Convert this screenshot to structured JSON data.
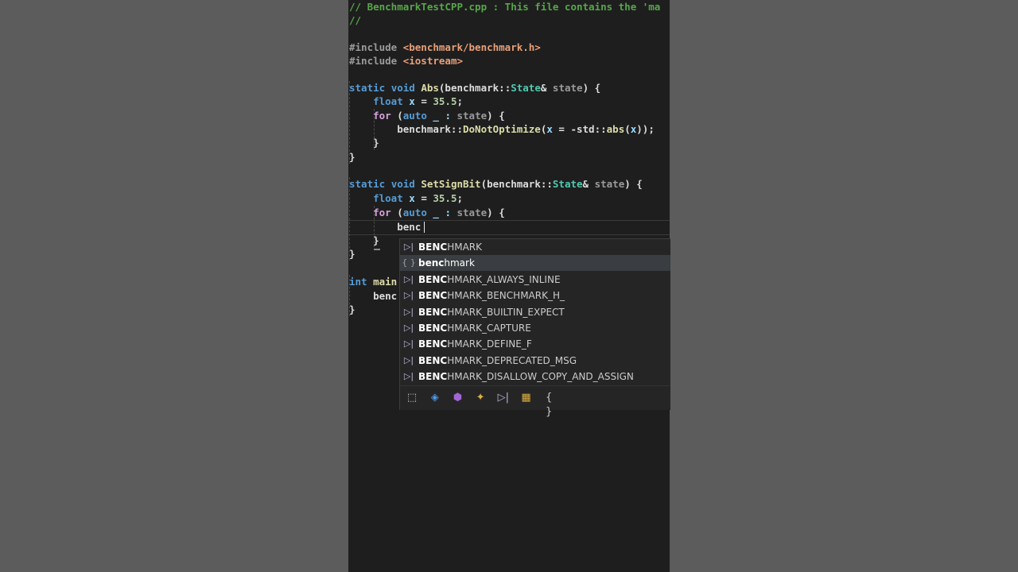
{
  "editor": {
    "lines": [
      {
        "tokens": [
          {
            "t": "// BenchmarkTestCPP.cpp : This file contains the 'ma",
            "c": "comment"
          }
        ]
      },
      {
        "tokens": [
          {
            "t": "//",
            "c": "comment"
          }
        ]
      },
      {
        "tokens": []
      },
      {
        "tokens": [
          {
            "t": "#include ",
            "c": "pp"
          },
          {
            "t": "<benchmark/benchmark.h>",
            "c": "str"
          }
        ]
      },
      {
        "tokens": [
          {
            "t": "#include ",
            "c": "pp"
          },
          {
            "t": "<iostream>",
            "c": "str"
          }
        ]
      },
      {
        "tokens": []
      },
      {
        "tokens": [
          {
            "t": "static ",
            "c": "kw"
          },
          {
            "t": "void ",
            "c": "kw"
          },
          {
            "t": "Abs",
            "c": "fn"
          },
          {
            "t": "(benchmark::",
            "c": "plain"
          },
          {
            "t": "State",
            "c": "type"
          },
          {
            "t": "& ",
            "c": "plain"
          },
          {
            "t": "state",
            "c": "param"
          },
          {
            "t": ") {",
            "c": "plain"
          }
        ]
      },
      {
        "tokens": [
          {
            "t": "    ",
            "c": "plain"
          },
          {
            "t": "float ",
            "c": "kw"
          },
          {
            "t": "x",
            "c": "var"
          },
          {
            "t": " = ",
            "c": "plain"
          },
          {
            "t": "35.5",
            "c": "num"
          },
          {
            "t": ";",
            "c": "plain"
          }
        ]
      },
      {
        "tokens": [
          {
            "t": "    ",
            "c": "plain"
          },
          {
            "t": "for ",
            "c": "ctl"
          },
          {
            "t": "(",
            "c": "plain"
          },
          {
            "t": "auto ",
            "c": "kw"
          },
          {
            "t": "_ : ",
            "c": "var"
          },
          {
            "t": "state",
            "c": "param"
          },
          {
            "t": ") {",
            "c": "plain"
          }
        ]
      },
      {
        "tokens": [
          {
            "t": "        benchmark::",
            "c": "plain"
          },
          {
            "t": "DoNotOptimize",
            "c": "fn"
          },
          {
            "t": "(",
            "c": "plain"
          },
          {
            "t": "x",
            "c": "var"
          },
          {
            "t": " = -std::",
            "c": "plain"
          },
          {
            "t": "abs",
            "c": "fn"
          },
          {
            "t": "(",
            "c": "plain"
          },
          {
            "t": "x",
            "c": "var"
          },
          {
            "t": "));",
            "c": "plain"
          }
        ]
      },
      {
        "tokens": [
          {
            "t": "    }",
            "c": "plain"
          }
        ]
      },
      {
        "tokens": [
          {
            "t": "}",
            "c": "plain"
          }
        ]
      },
      {
        "tokens": []
      },
      {
        "tokens": [
          {
            "t": "static ",
            "c": "kw"
          },
          {
            "t": "void ",
            "c": "kw"
          },
          {
            "t": "SetSignBit",
            "c": "fn"
          },
          {
            "t": "(benchmark::",
            "c": "plain"
          },
          {
            "t": "State",
            "c": "type"
          },
          {
            "t": "& ",
            "c": "plain"
          },
          {
            "t": "state",
            "c": "param"
          },
          {
            "t": ") {",
            "c": "plain"
          }
        ]
      },
      {
        "tokens": [
          {
            "t": "    ",
            "c": "plain"
          },
          {
            "t": "float ",
            "c": "kw"
          },
          {
            "t": "x",
            "c": "var"
          },
          {
            "t": " = ",
            "c": "plain"
          },
          {
            "t": "35.5",
            "c": "num"
          },
          {
            "t": ";",
            "c": "plain"
          }
        ]
      },
      {
        "tokens": [
          {
            "t": "    ",
            "c": "plain"
          },
          {
            "t": "for ",
            "c": "ctl"
          },
          {
            "t": "(",
            "c": "plain"
          },
          {
            "t": "auto ",
            "c": "kw"
          },
          {
            "t": "_ : ",
            "c": "var"
          },
          {
            "t": "state",
            "c": "param"
          },
          {
            "t": ") {",
            "c": "plain"
          }
        ]
      },
      {
        "tokens": [
          {
            "t": "        benc",
            "c": "plain"
          }
        ]
      },
      {
        "tokens": [
          {
            "t": "    }",
            "c": "plain"
          }
        ]
      },
      {
        "tokens": [
          {
            "t": "}",
            "c": "plain"
          }
        ]
      },
      {
        "tokens": []
      },
      {
        "tokens": [
          {
            "t": "int ",
            "c": "kw"
          },
          {
            "t": "main",
            "c": "fn"
          }
        ]
      },
      {
        "tokens": [
          {
            "t": "    benc",
            "c": "plain"
          }
        ]
      },
      {
        "tokens": [
          {
            "t": "}",
            "c": "plain"
          }
        ]
      }
    ]
  },
  "suggest": {
    "typed": "benc",
    "items": [
      {
        "kind": "macro",
        "icon": "macro-icon",
        "glyph": "▷|",
        "match": "BENC",
        "rest": "HMARK",
        "selected": false
      },
      {
        "kind": "namespace",
        "icon": "namespace-icon",
        "glyph": "{ }",
        "match": "benc",
        "rest": "hmark",
        "selected": true
      },
      {
        "kind": "macro",
        "icon": "macro-icon",
        "glyph": "▷|",
        "match": "BENC",
        "rest": "HMARK_ALWAYS_INLINE",
        "selected": false
      },
      {
        "kind": "macro",
        "icon": "macro-icon",
        "glyph": "▷|",
        "match": "BENC",
        "rest": "HMARK_BENCHMARK_H_",
        "selected": false
      },
      {
        "kind": "macro",
        "icon": "macro-icon",
        "glyph": "▷|",
        "match": "BENC",
        "rest": "HMARK_BUILTIN_EXPECT",
        "selected": false
      },
      {
        "kind": "macro",
        "icon": "macro-icon",
        "glyph": "▷|",
        "match": "BENC",
        "rest": "HMARK_CAPTURE",
        "selected": false
      },
      {
        "kind": "macro",
        "icon": "macro-icon",
        "glyph": "▷|",
        "match": "BENC",
        "rest": "HMARK_DEFINE_F",
        "selected": false
      },
      {
        "kind": "macro",
        "icon": "macro-icon",
        "glyph": "▷|",
        "match": "BENC",
        "rest": "HMARK_DEPRECATED_MSG",
        "selected": false
      },
      {
        "kind": "macro",
        "icon": "macro-icon",
        "glyph": "▷|",
        "match": "BENC",
        "rest": "HMARK_DISALLOW_COPY_AND_ASSIGN",
        "selected": false
      }
    ],
    "filters": [
      {
        "name": "filter-all-icon",
        "glyph": "⬚",
        "color": "#d0d0d0"
      },
      {
        "name": "filter-class-icon",
        "glyph": "◈",
        "color": "#4e9ae6"
      },
      {
        "name": "filter-struct-icon",
        "glyph": "⬢",
        "color": "#a366d6"
      },
      {
        "name": "filter-member-icon",
        "glyph": "✦",
        "color": "#e0b040"
      },
      {
        "name": "filter-macro-icon",
        "glyph": "▷|",
        "color": "#b8b8d8"
      },
      {
        "name": "filter-enum-icon",
        "glyph": "▦",
        "color": "#e0b040"
      },
      {
        "name": "filter-namespace-icon",
        "glyph": "{ }",
        "color": "#d0d0d0"
      }
    ]
  },
  "colors": {
    "background": "#5c5c5c",
    "editor": "#1e1e1e",
    "suggest_bg": "#252526",
    "selected": "#3a3d41"
  }
}
